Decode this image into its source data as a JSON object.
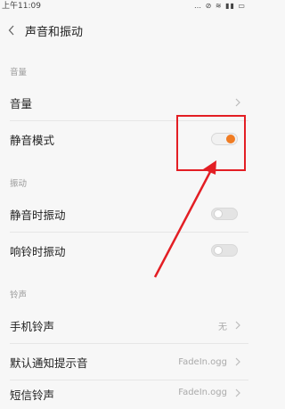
{
  "status_bar": {
    "time": "上午11:09",
    "icons": "… ⊘ ≋ ▮▮ ▭"
  },
  "header": {
    "back_icon": "chevron-left-icon",
    "title": "声音和振动"
  },
  "sections": {
    "volume_header": "音量",
    "vibration_header": "振动",
    "ringtone_header": "铃声"
  },
  "rows": {
    "volume": {
      "label": "音量"
    },
    "silent_mode": {
      "label": "静音模式",
      "toggle": "on"
    },
    "vibrate_silent": {
      "label": "静音时振动",
      "toggle": "off"
    },
    "vibrate_ring": {
      "label": "响铃时振动",
      "toggle": "off"
    },
    "phone_ringtone": {
      "label": "手机铃声",
      "value": "无"
    },
    "notification_sound": {
      "label": "默认通知提示音",
      "value": "FadeIn.ogg"
    },
    "sms_ringtone": {
      "label": "短信铃声",
      "value": "FadeIn.ogg"
    }
  },
  "colors": {
    "accent": "#f07c23",
    "annotation": "#e31e24"
  }
}
